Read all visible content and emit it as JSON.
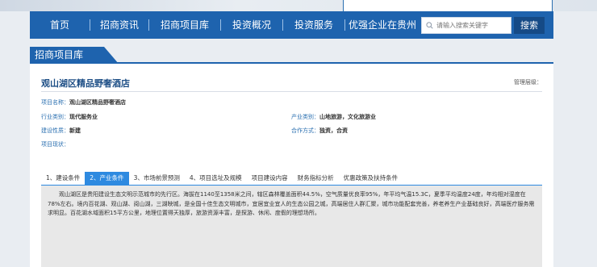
{
  "nav": {
    "items": [
      "首页",
      "招商资讯",
      "招商项目库",
      "投资概况",
      "投资服务",
      "优强企业在贵州"
    ],
    "search_placeholder": "请输入搜索关键字",
    "search_button": "搜索"
  },
  "panel": {
    "tab_label": "招商项目库",
    "title": "观山湖区精品野奢酒店",
    "manage_label": "管理层级："
  },
  "fields": {
    "name_label": "项目名称：",
    "name_value": "观山湖区精品野奢酒店",
    "industry_label": "行业类别：",
    "industry_value": "现代服务业",
    "sector_label": "产业类别：",
    "sector_value": "山地旅游，文化旅游业",
    "nature_label": "建设性质：",
    "nature_value": "新建",
    "coop_label": "合作方式：",
    "coop_value": "独资，合资",
    "status_label": "项目现状："
  },
  "tabs": [
    "1、建设条件",
    "2、产业条件",
    "3、市场前景预测",
    "4、项目选址及规模",
    "项目建设内容",
    "财务指标分析",
    "优惠政策及扶持条件"
  ],
  "active_tab_index": 1,
  "content_text": "观山湖区是贵阳建设生态文明示范城市的先行区。海拔在1140至1358米之间，辖区森林覆盖面积44.5%，空气质量优良率95%，年平均气温15.3C，夏季平均温度24度，年均相对湿度在78%左右。境内百花湖、观山湖、阅山湖，三湖映城，是全国十佳生态文明城市，宜居宜业宜人的生态公园之城，高端居住人群汇聚，城市功能配套完善，养老养生产业基础良好，高端医疗服务需求明显。百花湖水域面积15平方公里，地理位置得天独厚，旅游资源丰富，是探游、休闲、度假的理想场所。",
  "colors": {
    "nav_bg": "#1e63ae",
    "active_tab": "#2e8ae0",
    "search_button_bg": "#154a86"
  },
  "icons": {
    "search": "search-icon"
  }
}
